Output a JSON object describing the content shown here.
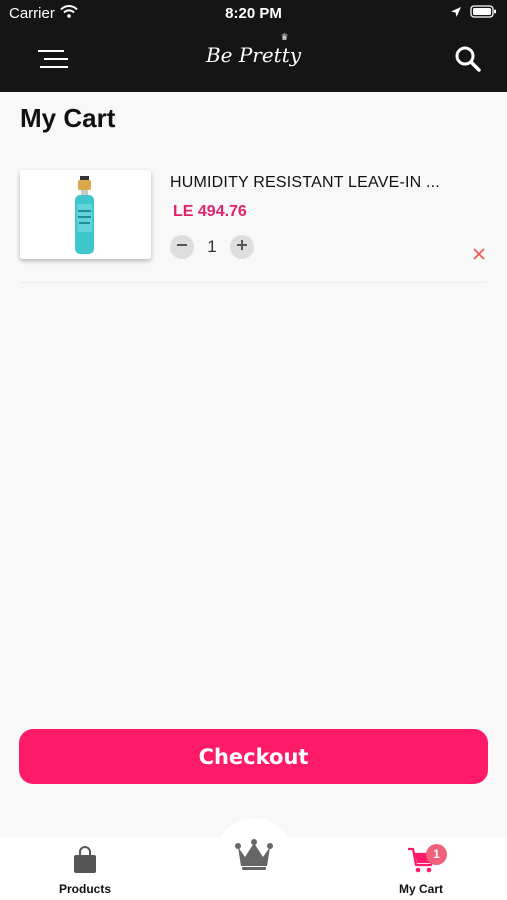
{
  "status_bar": {
    "carrier": "Carrier",
    "time": "8:20 PM",
    "icons": [
      "wifi-icon",
      "location-arrow-icon",
      "battery-icon"
    ]
  },
  "header": {
    "brand": "Be Pretty",
    "icons": [
      "menu-icon",
      "search-icon"
    ]
  },
  "page": {
    "title": "My Cart"
  },
  "cart": {
    "items": [
      {
        "name": "HUMIDITY RESISTANT LEAVE-IN ...",
        "price": "LE 494.76",
        "quantity": "1",
        "icons": [
          "minus-icon",
          "plus-icon",
          "close-icon"
        ]
      }
    ]
  },
  "checkout": {
    "label": "Checkout"
  },
  "tab_bar": {
    "tabs": [
      {
        "label": "Products",
        "icon": "shopping-bag-icon"
      },
      {
        "label": "",
        "icon": "crown-icon"
      },
      {
        "label": "My Cart",
        "icon": "cart-icon",
        "badge": "1"
      }
    ]
  },
  "colors": {
    "accent": "#fd1b69",
    "price": "#e0226e",
    "header_bg": "#151515",
    "remove": "#f05a5a",
    "badge": "#f0607a"
  }
}
